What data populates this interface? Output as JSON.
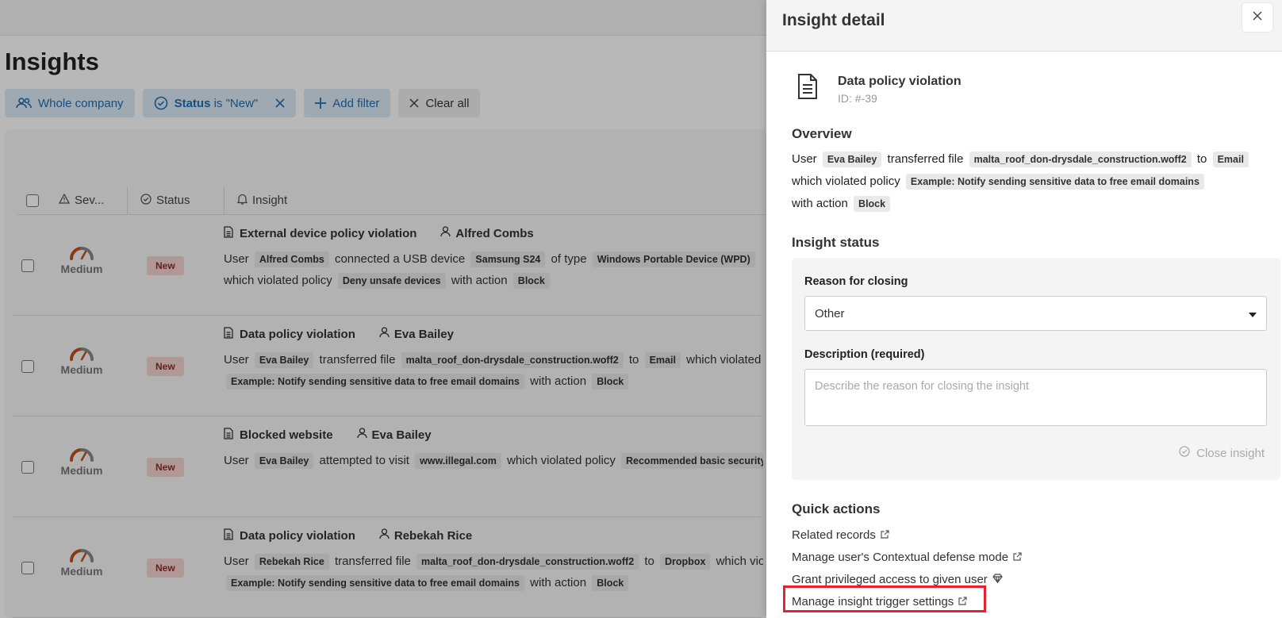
{
  "page": {
    "title": "Insights",
    "filters": {
      "company": "Whole company",
      "status_key": "Status",
      "status_rest": " is \"New\"",
      "add_filter": "Add filter",
      "clear_all": "Clear all"
    },
    "columns": {
      "severity": "Sev...",
      "status": "Status",
      "insight": "Insight"
    },
    "rows": [
      {
        "severity": "Medium",
        "status": "New",
        "title": "External device policy violation",
        "user": "Alfred Combs",
        "line1": [
          {
            "t": "User "
          },
          {
            "tag": "Alfred Combs"
          },
          {
            "t": " connected a USB device "
          },
          {
            "tag": "Samsung S24"
          },
          {
            "t": " of type "
          },
          {
            "tag": "Windows Portable Device (WPD)"
          }
        ],
        "line2": [
          {
            "t": "which violated policy "
          },
          {
            "tag": "Deny unsafe devices"
          },
          {
            "t": " with action "
          },
          {
            "tag": "Block"
          }
        ]
      },
      {
        "severity": "Medium",
        "status": "New",
        "title": "Data policy violation",
        "user": "Eva Bailey",
        "line1": [
          {
            "t": "User "
          },
          {
            "tag": "Eva Bailey"
          },
          {
            "t": " transferred file "
          },
          {
            "tag": "malta_roof_don-drysdale_construction.woff2"
          },
          {
            "t": " to "
          },
          {
            "tag": "Email"
          },
          {
            "t": " which violated policy"
          }
        ],
        "line2": [
          {
            "tag": "Example: Notify sending sensitive data to free email domains"
          },
          {
            "t": " with action "
          },
          {
            "tag": "Block"
          }
        ]
      },
      {
        "severity": "Medium",
        "status": "New",
        "title": "Blocked website",
        "user": "Eva Bailey",
        "line1": [
          {
            "t": "User "
          },
          {
            "tag": "Eva Bailey"
          },
          {
            "t": " attempted to visit "
          },
          {
            "tag": "www.illegal.com"
          },
          {
            "t": " which violated policy "
          },
          {
            "tag": "Recommended basic security"
          }
        ],
        "line2": []
      },
      {
        "severity": "Medium",
        "status": "New",
        "title": "Data policy violation",
        "user": "Rebekah Rice",
        "line1": [
          {
            "t": "User "
          },
          {
            "tag": "Rebekah Rice"
          },
          {
            "t": " transferred file "
          },
          {
            "tag": "malta_roof_don-drysdale_construction.woff2"
          },
          {
            "t": " to "
          },
          {
            "tag": "Dropbox"
          },
          {
            "t": " which violated policy"
          }
        ],
        "line2": [
          {
            "tag": "Example: Notify sending sensitive data to free email domains"
          },
          {
            "t": " with action "
          },
          {
            "tag": "Block"
          }
        ]
      }
    ]
  },
  "drawer": {
    "title": "Insight detail",
    "detail": {
      "name": "Data policy violation",
      "id": "ID: #-39"
    },
    "overview": {
      "title": "Overview",
      "lines": [
        [
          {
            "t": "User "
          },
          {
            "tag": "Eva Bailey"
          },
          {
            "t": " transferred file "
          },
          {
            "tag": "malta_roof_don-drysdale_construction.woff2"
          },
          {
            "t": " to "
          },
          {
            "tag": "Email"
          }
        ],
        [
          {
            "t": "which violated policy "
          },
          {
            "tag": "Example: Notify sending sensitive data to free email domains"
          }
        ],
        [
          {
            "t": "with action "
          },
          {
            "tag": "Block"
          }
        ]
      ]
    },
    "status": {
      "title": "Insight status",
      "reason_label": "Reason for closing",
      "reason_value": "Other",
      "description_label": "Description (required)",
      "description_placeholder": "Describe the reason for closing the insight",
      "close_button": "Close insight"
    },
    "quick_actions": {
      "title": "Quick actions",
      "related_records": "Related records",
      "contextual_defense": "Manage user's Contextual defense mode",
      "privileged_access": "Grant privileged access to given user",
      "trigger_settings": "Manage insight trigger settings"
    }
  },
  "colors": {
    "accent": "#1f6fb2",
    "highlight": "#e5222f",
    "severity_medium": "#c0501c",
    "new_badge_bg": "#f3d3d0"
  }
}
